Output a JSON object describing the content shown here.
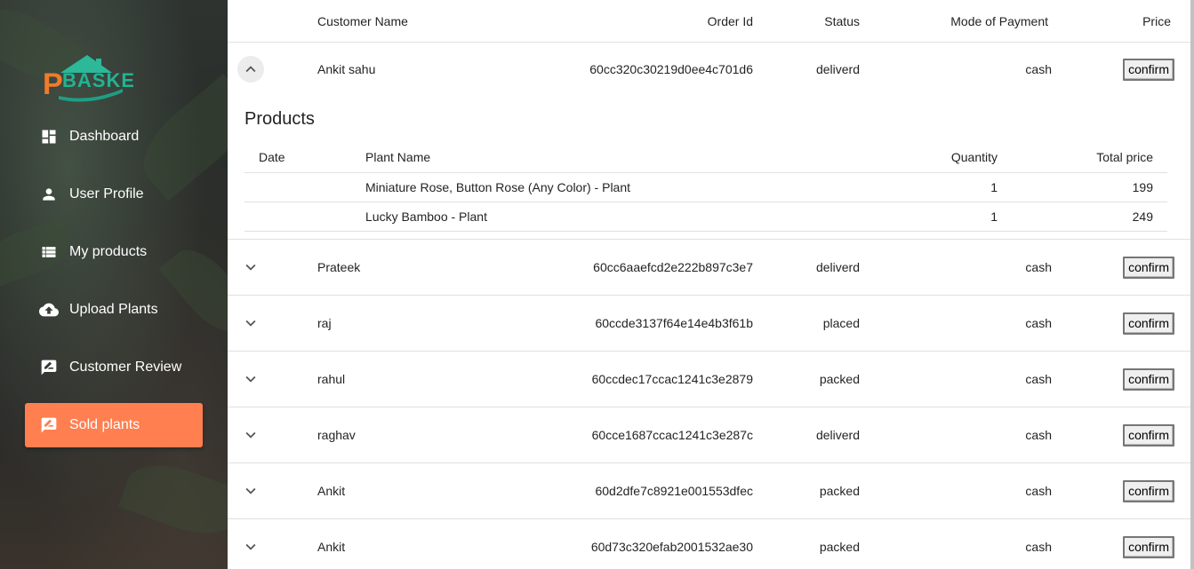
{
  "app": {
    "logo_text": "PBASKET"
  },
  "sidebar": {
    "items": [
      {
        "label": "Dashboard",
        "icon": "dashboard-icon"
      },
      {
        "label": "User Profile",
        "icon": "user-icon"
      },
      {
        "label": "My products",
        "icon": "list-icon"
      },
      {
        "label": "Upload Plants",
        "icon": "cloud-upload-icon"
      },
      {
        "label": "Customer Review",
        "icon": "rate-review-icon"
      },
      {
        "label": "Sold plants",
        "icon": "rate-review-icon",
        "active": true
      }
    ],
    "active_color": "#ff7f50"
  },
  "orders_table": {
    "headers": {
      "customer_name": "Customer Name",
      "order_id": "Order Id",
      "status": "Status",
      "payment": "Mode of Payment",
      "price": "Price"
    },
    "confirm_label": "confirm",
    "rows": [
      {
        "name": "Ankit sahu",
        "order_id": "60cc320c30219d0ee4c701d6",
        "status": "deliverd",
        "payment": "cash",
        "expanded": true
      },
      {
        "name": "Prateek",
        "order_id": "60cc6aaefcd2e222b897c3e7",
        "status": "deliverd",
        "payment": "cash"
      },
      {
        "name": "raj",
        "order_id": "60ccde3137f64e14e4b3f61b",
        "status": "placed",
        "payment": "cash"
      },
      {
        "name": "rahul",
        "order_id": "60ccdec17ccac1241c3e2879",
        "status": "packed",
        "payment": "cash"
      },
      {
        "name": "raghav",
        "order_id": "60cce1687ccac1241c3e287c",
        "status": "deliverd",
        "payment": "cash"
      },
      {
        "name": "Ankit",
        "order_id": "60d2dfe7c8921e001553dfec",
        "status": "packed",
        "payment": "cash"
      },
      {
        "name": "Ankit",
        "order_id": "60d73c320efab2001532ae30",
        "status": "packed",
        "payment": "cash"
      }
    ]
  },
  "products": {
    "title": "Products",
    "headers": {
      "date": "Date",
      "plant_name": "Plant Name",
      "quantity": "Quantity",
      "total_price": "Total price"
    },
    "items": [
      {
        "date": "",
        "plant_name": "Miniature Rose, Button Rose (Any Color) - Plant",
        "quantity": "1",
        "total_price": "199"
      },
      {
        "date": "",
        "plant_name": "Lucky Bamboo - Plant",
        "quantity": "1",
        "total_price": "249"
      }
    ]
  }
}
